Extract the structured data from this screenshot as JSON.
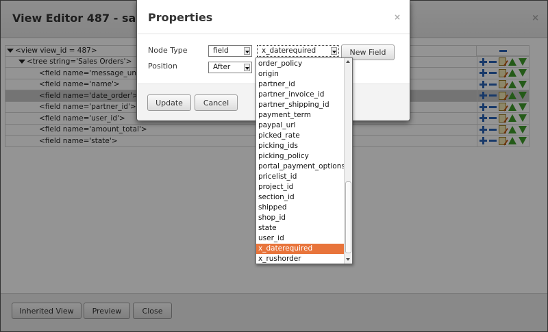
{
  "editor": {
    "title": "View Editor 487 - sale.or",
    "close_glyph": "×",
    "tree": [
      {
        "label": "<view view_id = 487>",
        "level": 0,
        "expanded": true
      },
      {
        "label": "<tree string='Sales Orders'>",
        "level": 1,
        "expanded": true
      },
      {
        "label": "<field name='message_unre",
        "level": 2
      },
      {
        "label": "<field name='name'>",
        "level": 2
      },
      {
        "label": "<field name='date_order'>",
        "level": 2,
        "selected": true
      },
      {
        "label": "<field name='partner_id'>",
        "level": 2
      },
      {
        "label": "<field name='user_id'>",
        "level": 2
      },
      {
        "label": "<field name='amount_total'>",
        "level": 2
      },
      {
        "label": "<field name='state'>",
        "level": 2
      }
    ],
    "footer": {
      "inherited_view_label": "Inherited View",
      "preview_label": "Preview",
      "close_label": "Close"
    }
  },
  "dialog": {
    "title": "Properties",
    "close_glyph": "×",
    "node_type_label": "Node Type",
    "node_type_value": "field",
    "field_value": "x_daterequired",
    "new_field_label": "New Field",
    "position_label": "Position",
    "position_value": "After",
    "update_label": "Update",
    "cancel_label": "Cancel"
  },
  "dropdown": {
    "options": [
      "order_policy",
      "origin",
      "partner_id",
      "partner_invoice_id",
      "partner_shipping_id",
      "payment_term",
      "paypal_url",
      "picked_rate",
      "picking_ids",
      "picking_policy",
      "portal_payment_options",
      "pricelist_id",
      "project_id",
      "section_id",
      "shipped",
      "shop_id",
      "state",
      "user_id",
      "x_daterequired",
      "x_rushorder"
    ],
    "highlighted": "x_daterequired"
  },
  "colors": {
    "highlight": "#e8743b",
    "icon_blue": "#2a62b6",
    "icon_green": "#3f9b2a"
  }
}
